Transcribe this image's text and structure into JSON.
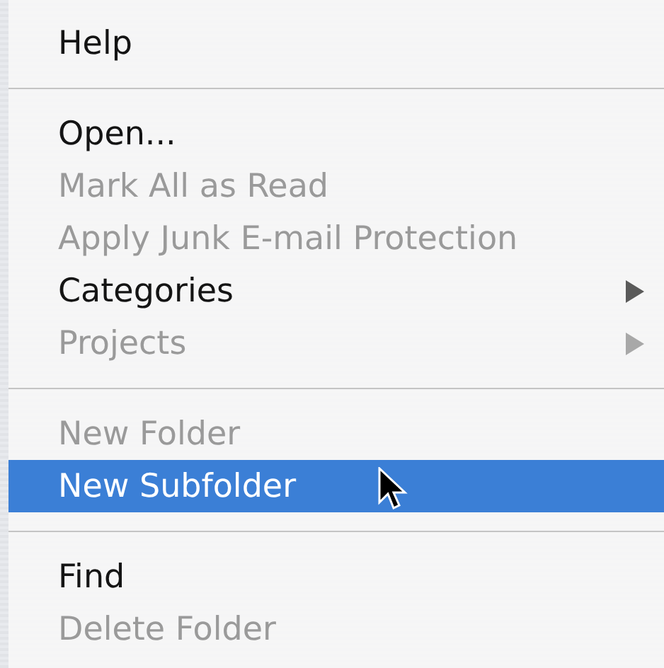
{
  "menu": {
    "items": [
      {
        "kind": "item",
        "label": "Help",
        "disabled": false,
        "selected": false,
        "submenu": false
      },
      {
        "kind": "separator"
      },
      {
        "kind": "item",
        "label": "Open...",
        "disabled": false,
        "selected": false,
        "submenu": false
      },
      {
        "kind": "item",
        "label": "Mark All as Read",
        "disabled": true,
        "selected": false,
        "submenu": false
      },
      {
        "kind": "item",
        "label": "Apply Junk E-mail Protection",
        "disabled": true,
        "selected": false,
        "submenu": false
      },
      {
        "kind": "item",
        "label": "Categories",
        "disabled": false,
        "selected": false,
        "submenu": true
      },
      {
        "kind": "item",
        "label": "Projects",
        "disabled": true,
        "selected": false,
        "submenu": true
      },
      {
        "kind": "separator"
      },
      {
        "kind": "item",
        "label": "New Folder",
        "disabled": true,
        "selected": false,
        "submenu": false
      },
      {
        "kind": "item",
        "label": "New Subfolder",
        "disabled": false,
        "selected": true,
        "submenu": false
      },
      {
        "kind": "separator"
      },
      {
        "kind": "item",
        "label": "Find",
        "disabled": false,
        "selected": false,
        "submenu": false
      },
      {
        "kind": "item",
        "label": "Delete Folder",
        "disabled": true,
        "selected": false,
        "submenu": false
      }
    ]
  }
}
